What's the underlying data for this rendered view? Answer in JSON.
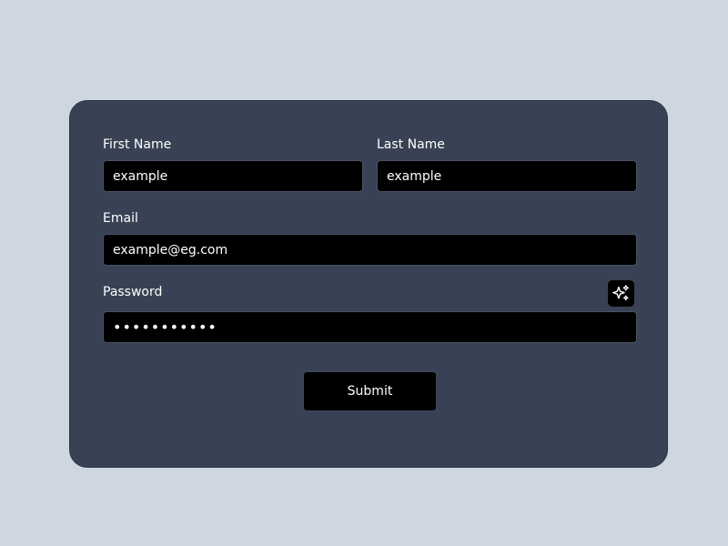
{
  "form": {
    "first_name": {
      "label": "First Name",
      "value": "example"
    },
    "last_name": {
      "label": "Last Name",
      "value": "example"
    },
    "email": {
      "label": "Email",
      "value": "example@eg.com"
    },
    "password": {
      "label": "Password",
      "value": "•••••••••••"
    },
    "generate_icon": "sparkles-icon",
    "submit_label": "Submit"
  },
  "colors": {
    "background": "#cdd6e1",
    "card": "#384254",
    "field": "#000000",
    "text": "#ffffff"
  }
}
